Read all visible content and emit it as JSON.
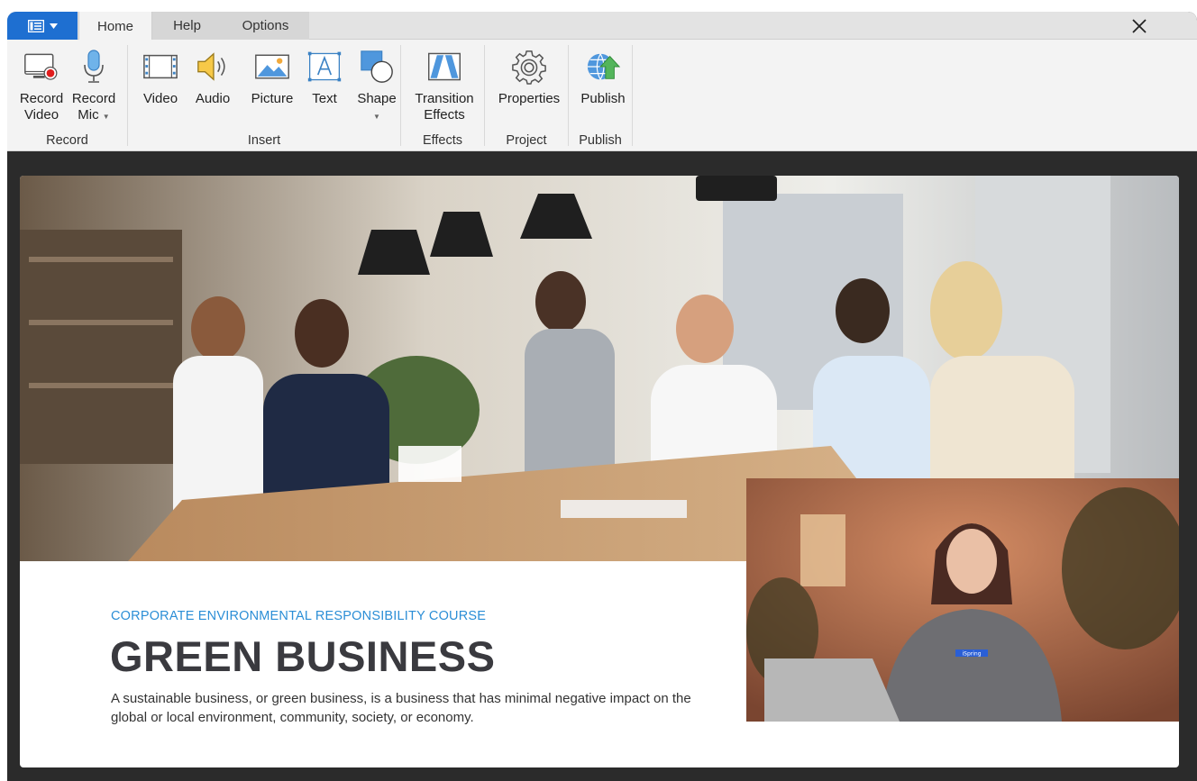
{
  "tabs": {
    "home": "Home",
    "help": "Help",
    "options": "Options"
  },
  "ribbon": {
    "groups": {
      "record": "Record",
      "insert": "Insert",
      "effects": "Effects",
      "project": "Project",
      "publish": "Publish"
    },
    "buttons": {
      "record_video": [
        "Record",
        "Video"
      ],
      "record_mic": [
        "Record",
        "Mic"
      ],
      "video": "Video",
      "audio": "Audio",
      "picture": "Picture",
      "text": "Text",
      "shape": "Shape",
      "transition_effects": [
        "Transition",
        "Effects"
      ],
      "properties": "Properties",
      "publish": "Publish"
    }
  },
  "slide": {
    "course_tag": "CORPORATE ENVIRONMENTAL RESPONSIBILITY COURSE",
    "title": "GREEN BUSINESS",
    "description": "A sustainable business, or green business, is a business that has minimal negative impact on the global or local environment, community, society, or economy.",
    "presenter_badge": "iSpring"
  },
  "colors": {
    "accent": "#1e6fd1",
    "course_tag": "#2b8ed6",
    "title": "#3a3a3f",
    "record_dot": "#e01c1c"
  },
  "icons": {
    "app_menu": "app-menu-icon",
    "close": "close-icon"
  }
}
